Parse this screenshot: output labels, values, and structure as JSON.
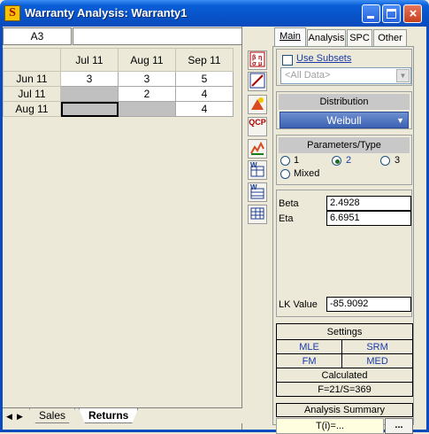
{
  "window": {
    "app_icon_glyph": "S",
    "title": "Warranty Analysis: Warranty1",
    "controls": [
      "minimize",
      "maximize",
      "close"
    ]
  },
  "spreadsheet": {
    "cell_ref": "A3",
    "formula": "",
    "columns": [
      "Jul 11",
      "Aug 11",
      "Sep 11"
    ],
    "rows": [
      {
        "label": "Jun 11",
        "values": [
          "3",
          "3",
          "5"
        ]
      },
      {
        "label": "Jul 11",
        "values": [
          "",
          "2",
          "4"
        ]
      },
      {
        "label": "Aug 11",
        "values": [
          "",
          "",
          "4"
        ]
      }
    ],
    "sheet_tabs": [
      "Sales",
      "Returns"
    ],
    "active_sheet": "Returns"
  },
  "toolbar": {
    "icons": [
      "distribution-wizard-icon",
      "plot-icon",
      "quick-statistical-reference-icon",
      "quick-calculation-pad-icon",
      "return-forecast-icon",
      "non-homogeneous-data-icon",
      "nevada-chart-icon",
      "spreadsheet-icon"
    ],
    "qcp_label": "QCP"
  },
  "panel": {
    "tabs": [
      "Main",
      "Analysis",
      "SPC",
      "Other"
    ],
    "active_tab": "Main",
    "use_subsets_label": "Use Subsets",
    "subset_value": "<All Data>",
    "distribution_header": "Distribution",
    "distribution_value": "Weibull",
    "params_header": "Parameters/Type",
    "param_options": [
      "1",
      "2",
      "3",
      "Mixed"
    ],
    "param_selected": "2",
    "beta_label": "Beta",
    "beta_value": "2.4928",
    "eta_label": "Eta",
    "eta_value": "6.6951",
    "lk_label": "LK Value",
    "lk_value": "-85.9092",
    "settings_header": "Settings",
    "settings": [
      "MLE",
      "SRM",
      "FM",
      "MED"
    ],
    "calculated_header": "Calculated",
    "calculated_value": "F=21/S=369",
    "summary_header": "Analysis Summary",
    "summary_value": "T(i)=...",
    "summary_button": "..."
  },
  "colors": {
    "titlebar": "#0a5fd8",
    "link_blue": "#1a3aa8",
    "distribution_blue": "#3c62b3"
  }
}
